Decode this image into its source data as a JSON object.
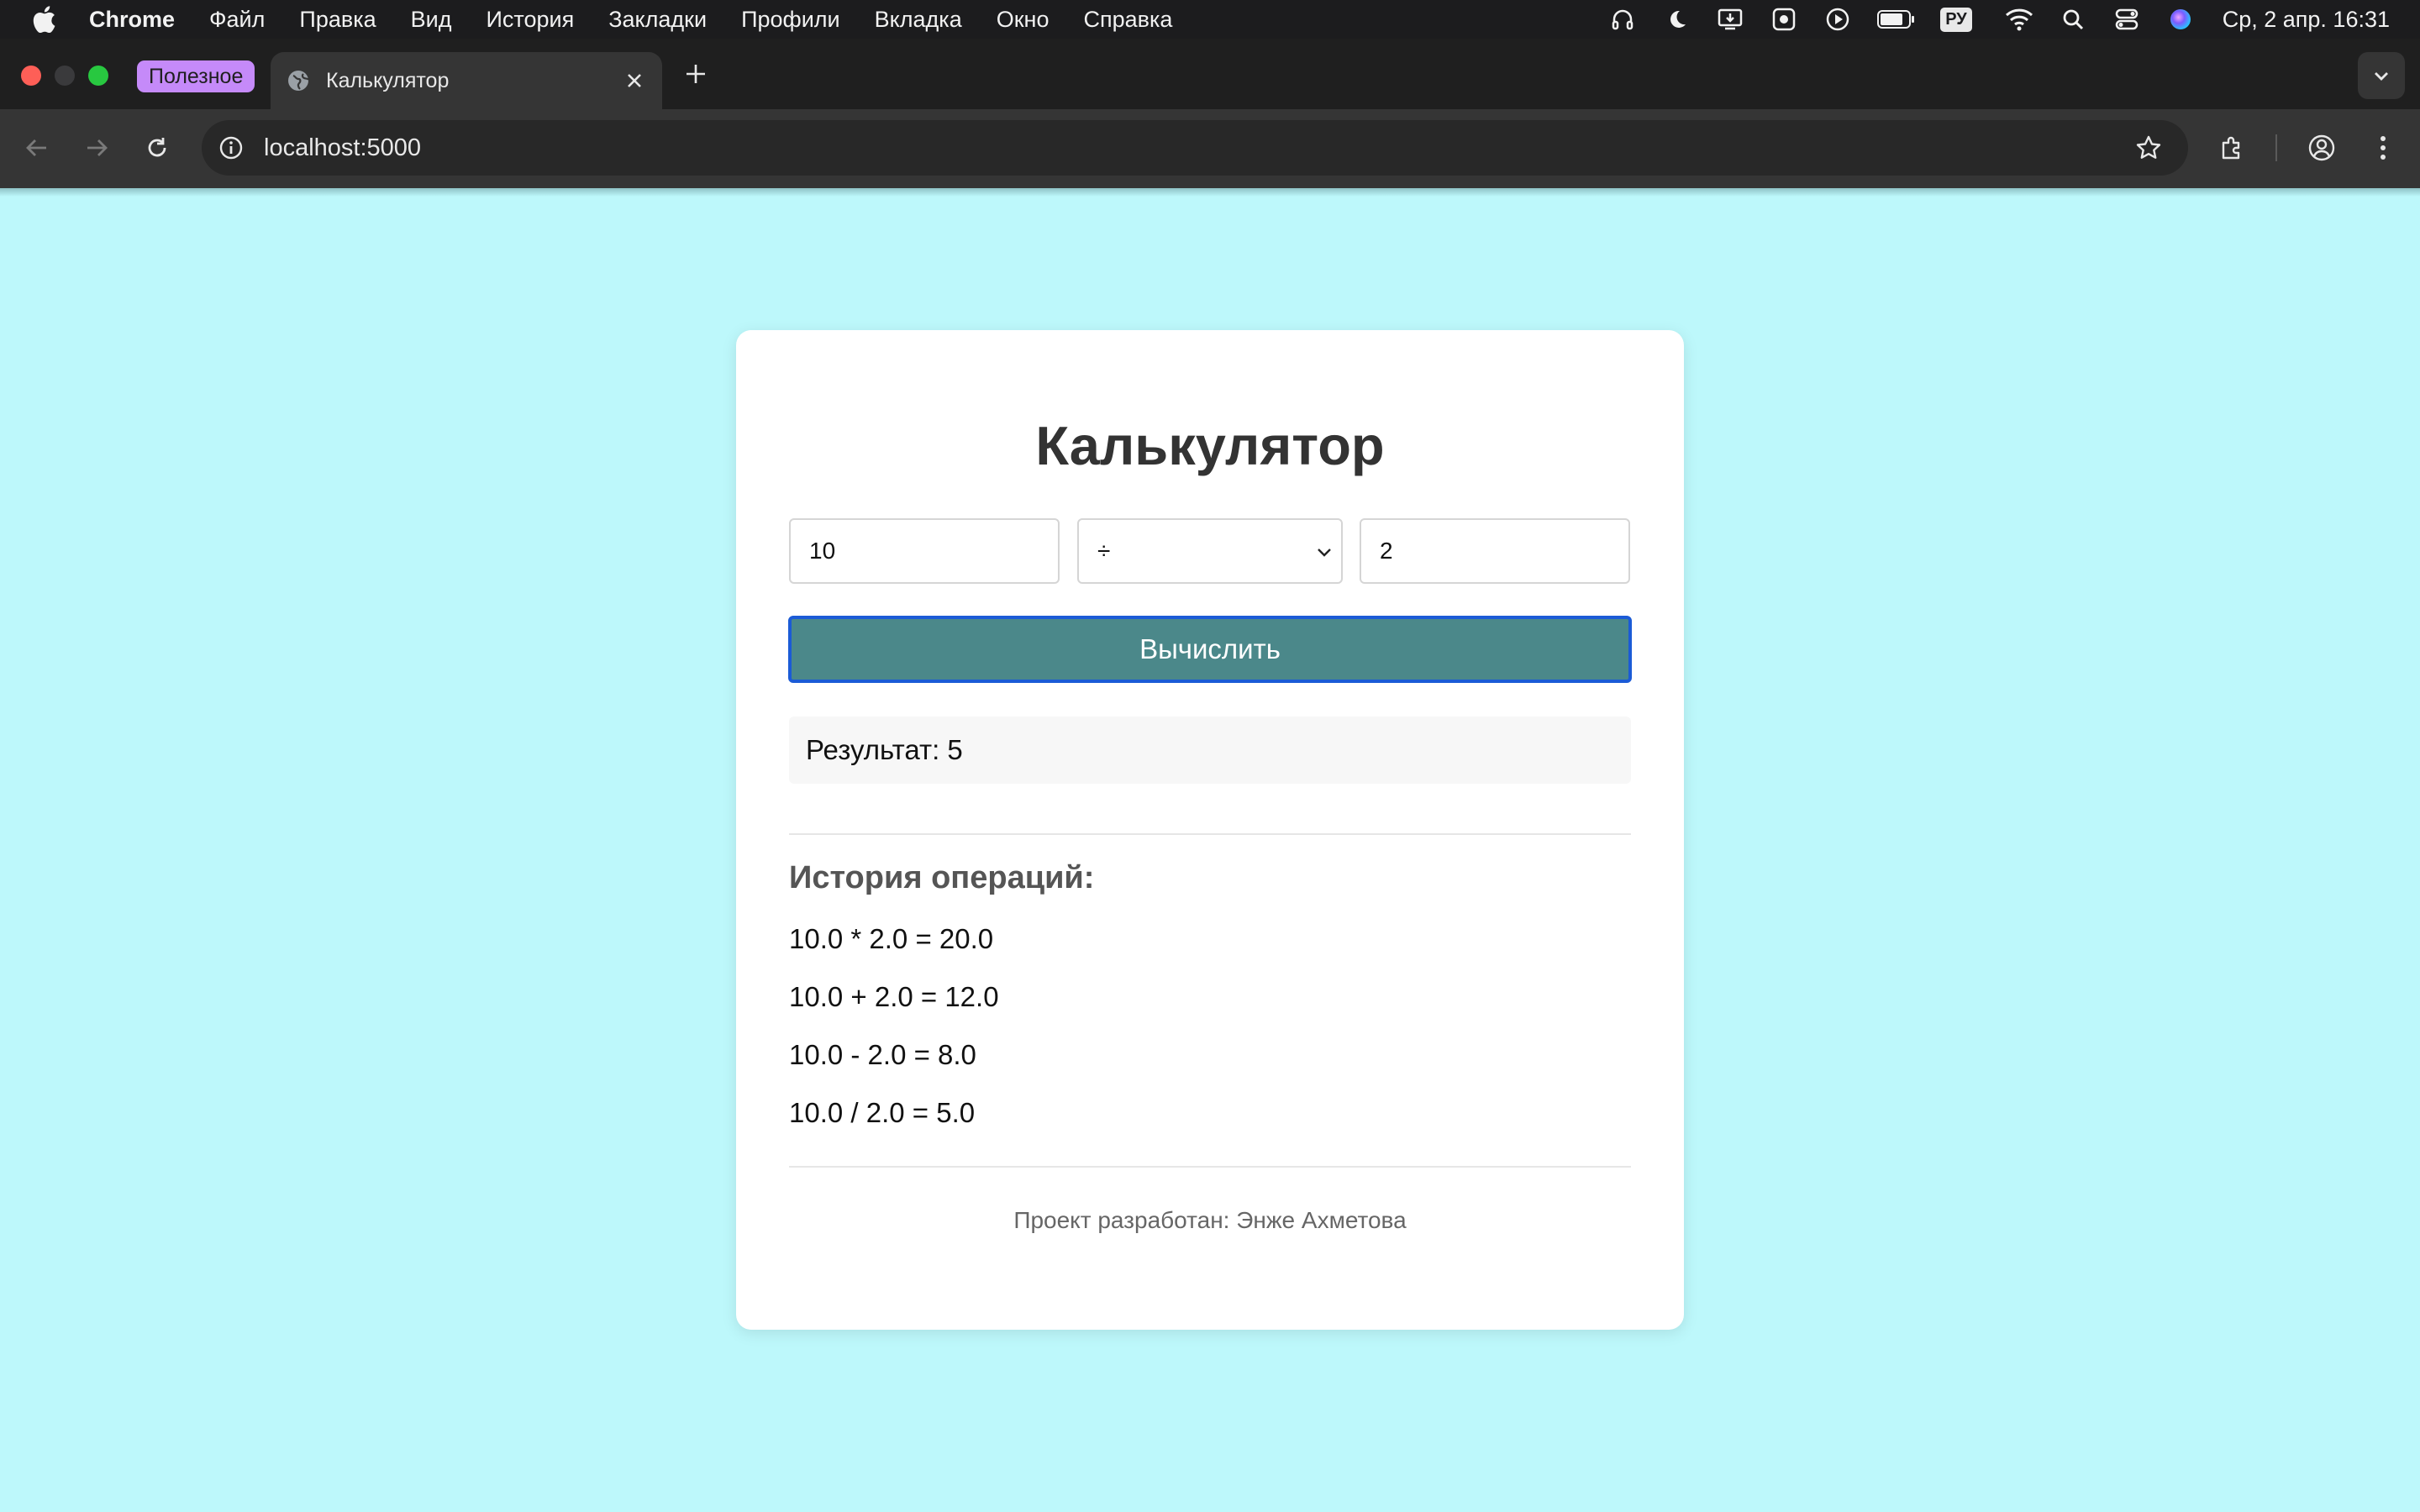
{
  "menubar": {
    "app_name": "Chrome",
    "items": [
      "Файл",
      "Правка",
      "Вид",
      "История",
      "Закладки",
      "Профили",
      "Вкладка",
      "Окно",
      "Справка"
    ],
    "input_lang": "РУ",
    "clock": "Ср, 2 апр.  16:31"
  },
  "browser": {
    "tab_group_label": "Полезное",
    "tab_group_color": "#c58af9",
    "tab_title": "Калькулятор",
    "url": "localhost:5000"
  },
  "calculator": {
    "title": "Калькулятор",
    "operand_a": "10",
    "operator": "÷",
    "operand_b": "2",
    "button_label": "Вычислить",
    "result_text": "Результат: 5",
    "history_title": "История операций:",
    "history": [
      "10.0 * 2.0 = 20.0",
      "10.0 + 2.0 = 12.0",
      "10.0 - 2.0 = 8.0",
      "10.0 / 2.0 = 5.0"
    ],
    "footer": "Проект разработан: Энже Ахметова"
  },
  "colors": {
    "page_background": "#bdf8fb",
    "button_background": "#4b888a",
    "button_focus_border": "#1b5bd6",
    "card_background": "#ffffff"
  }
}
